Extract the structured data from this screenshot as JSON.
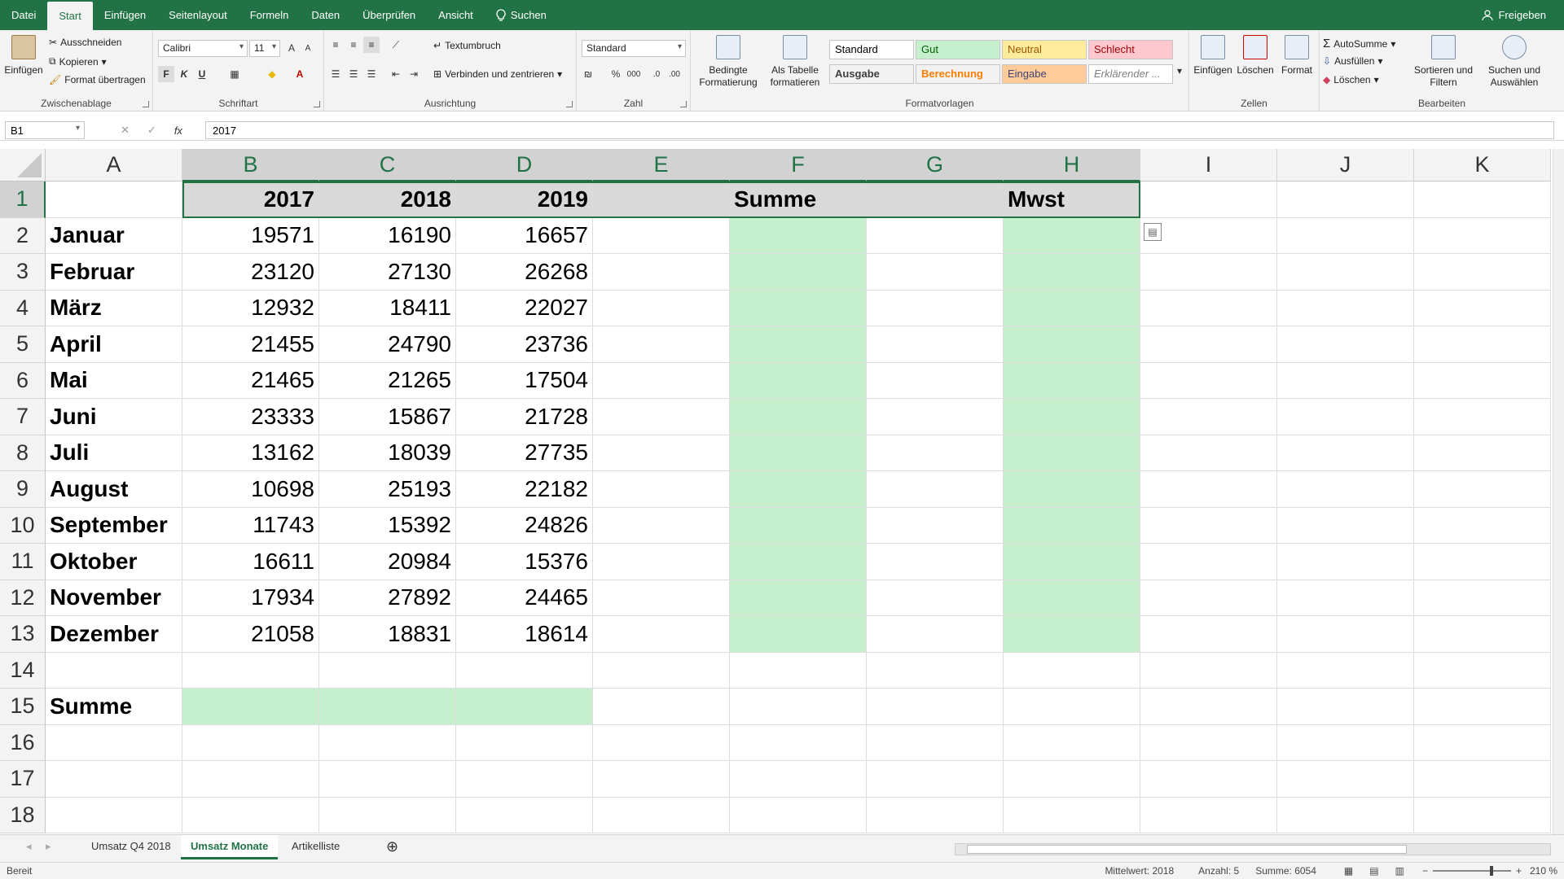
{
  "ribbon_tabs": [
    "Datei",
    "Start",
    "Einfügen",
    "Seitenlayout",
    "Formeln",
    "Daten",
    "Überprüfen",
    "Ansicht"
  ],
  "search_label": "Suchen",
  "share_label": "Freigeben",
  "clipboard": {
    "paste": "Einfügen",
    "cut": "Ausschneiden",
    "copy": "Kopieren",
    "format_painter": "Format übertragen",
    "label": "Zwischenablage"
  },
  "font": {
    "name": "Calibri",
    "size": "11",
    "bold": "F",
    "italic": "K",
    "underline": "U",
    "label": "Schriftart"
  },
  "alignment": {
    "wrap": "Textumbruch",
    "merge": "Verbinden und zentrieren",
    "label": "Ausrichtung"
  },
  "number": {
    "format": "Standard",
    "percent": "%",
    "thousands": "000",
    "label": "Zahl"
  },
  "styles": {
    "conditional": "Bedingte Formatierung",
    "as_table": "Als Tabelle formatieren",
    "cells": [
      {
        "text": "Standard",
        "bg": "#ffffff",
        "color": "#000000"
      },
      {
        "text": "Gut",
        "bg": "#c6efce",
        "color": "#006100"
      },
      {
        "text": "Neutral",
        "bg": "#ffeb9c",
        "color": "#9c5700"
      },
      {
        "text": "Schlecht",
        "bg": "#ffc7ce",
        "color": "#9c0006"
      },
      {
        "text": "Ausgabe",
        "bg": "#f2f2f2",
        "color": "#3f3f3f"
      },
      {
        "text": "Berechnung",
        "bg": "#f2f2f2",
        "color": "#fa7d00"
      },
      {
        "text": "Eingabe",
        "bg": "#ffcc99",
        "color": "#3f3f76"
      },
      {
        "text": "Erklärender ...",
        "bg": "#ffffff",
        "color": "#7f7f7f"
      }
    ],
    "label": "Formatvorlagen"
  },
  "cells_group": {
    "insert": "Einfügen",
    "delete": "Löschen",
    "format": "Format",
    "label": "Zellen"
  },
  "editing": {
    "autosum": "AutoSumme",
    "fill": "Ausfüllen",
    "clear": "Löschen",
    "sort": "Sortieren und Filtern",
    "find": "Suchen und Auswählen",
    "label": "Bearbeiten"
  },
  "formula_bar": {
    "name_box": "B1",
    "fx": "fx",
    "value": "2017"
  },
  "columns": [
    "A",
    "B",
    "C",
    "D",
    "E",
    "F",
    "G",
    "H",
    "I",
    "J",
    "K"
  ],
  "rows": [
    "1",
    "2",
    "3",
    "4",
    "5",
    "6",
    "7",
    "8",
    "9",
    "10",
    "11",
    "12",
    "13",
    "14",
    "15",
    "16",
    "17",
    "18"
  ],
  "header_row": {
    "B": "2017",
    "C": "2018",
    "D": "2019",
    "F": "Summe",
    "H": "Mwst"
  },
  "months": [
    "Januar",
    "Februar",
    "März",
    "April",
    "Mai",
    "Juni",
    "Juli",
    "August",
    "September",
    "Oktober",
    "November",
    "Dezember"
  ],
  "values": [
    [
      19571,
      16190,
      16657
    ],
    [
      23120,
      27130,
      26268
    ],
    [
      12932,
      18411,
      22027
    ],
    [
      21455,
      24790,
      23736
    ],
    [
      21465,
      21265,
      17504
    ],
    [
      23333,
      15867,
      21728
    ],
    [
      13162,
      18039,
      27735
    ],
    [
      10698,
      25193,
      22182
    ],
    [
      11743,
      15392,
      24826
    ],
    [
      16611,
      20984,
      15376
    ],
    [
      17934,
      27892,
      24465
    ],
    [
      21058,
      18831,
      18614
    ]
  ],
  "sum_label": "Summe",
  "sheet_tabs": [
    "Umsatz Q4 2018",
    "Umsatz Monate",
    "Artikelliste"
  ],
  "active_sheet": "Umsatz Monate",
  "status": {
    "ready": "Bereit",
    "average": "Mittelwert: 2018",
    "count": "Anzahl: 5",
    "sum": "Summe: 6054",
    "zoom": "210 %"
  },
  "colors": {
    "accent": "#217346",
    "highlight": "#c6efce"
  }
}
